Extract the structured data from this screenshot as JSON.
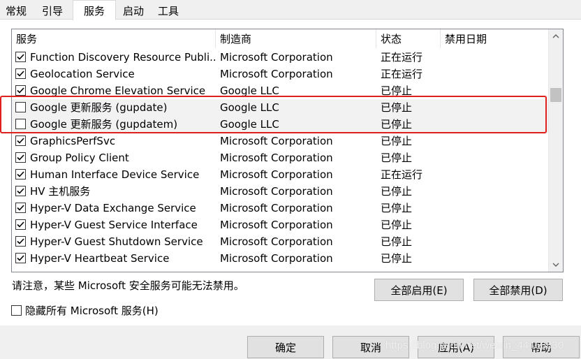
{
  "tabs": [
    {
      "label": "常规"
    },
    {
      "label": "引导"
    },
    {
      "label": "服务"
    },
    {
      "label": "启动"
    },
    {
      "label": "工具"
    }
  ],
  "active_tab": "服务",
  "list": {
    "columns": [
      "服务",
      "制造商",
      "状态",
      "禁用日期"
    ],
    "rows": [
      {
        "name": "Function Discovery Resource Publi...",
        "manufacturer": "Microsoft Corporation",
        "status": "正在运行",
        "date": "",
        "checked": true
      },
      {
        "name": "Geolocation Service",
        "manufacturer": "Microsoft Corporation",
        "status": "正在运行",
        "date": "",
        "checked": true
      },
      {
        "name": "Google Chrome Elevation Service",
        "manufacturer": "Google LLC",
        "status": "已停止",
        "date": "",
        "checked": true
      },
      {
        "name": "Google 更新服务 (gupdate)",
        "manufacturer": "Google LLC",
        "status": "已停止",
        "date": "",
        "checked": false
      },
      {
        "name": "Google 更新服务 (gupdatem)",
        "manufacturer": "Google LLC",
        "status": "已停止",
        "date": "",
        "checked": false
      },
      {
        "name": "GraphicsPerfSvc",
        "manufacturer": "Microsoft Corporation",
        "status": "已停止",
        "date": "",
        "checked": true
      },
      {
        "name": "Group Policy Client",
        "manufacturer": "Microsoft Corporation",
        "status": "已停止",
        "date": "",
        "checked": true
      },
      {
        "name": "Human Interface Device Service",
        "manufacturer": "Microsoft Corporation",
        "status": "正在运行",
        "date": "",
        "checked": true
      },
      {
        "name": "HV 主机服务",
        "manufacturer": "Microsoft Corporation",
        "status": "已停止",
        "date": "",
        "checked": true
      },
      {
        "name": "Hyper-V Data Exchange Service",
        "manufacturer": "Microsoft Corporation",
        "status": "已停止",
        "date": "",
        "checked": true
      },
      {
        "name": "Hyper-V Guest Service Interface",
        "manufacturer": "Microsoft Corporation",
        "status": "已停止",
        "date": "",
        "checked": true
      },
      {
        "name": "Hyper-V Guest Shutdown Service",
        "manufacturer": "Microsoft Corporation",
        "status": "已停止",
        "date": "",
        "checked": true
      },
      {
        "name": "Hyper-V Heartbeat Service",
        "manufacturer": "Microsoft Corporation",
        "status": "已停止",
        "date": "",
        "checked": true
      }
    ]
  },
  "note": "请注意，某些 Microsoft 安全服务可能无法禁用。",
  "enable_all_label": "全部启用(E)",
  "disable_all_label": "全部禁用(D)",
  "hide_ms_label": "隐藏所有 Microsoft 服务(H)",
  "footer": {
    "ok_label": "确定",
    "cancel_label": "取消",
    "apply_label": "应用(A)",
    "help_label": "帮助"
  },
  "watermark": "https://blog.csdn.net/weixin_44468830",
  "colors": {
    "highlight_box": "#e0201c",
    "row_highlight": "#f2f2f2"
  }
}
